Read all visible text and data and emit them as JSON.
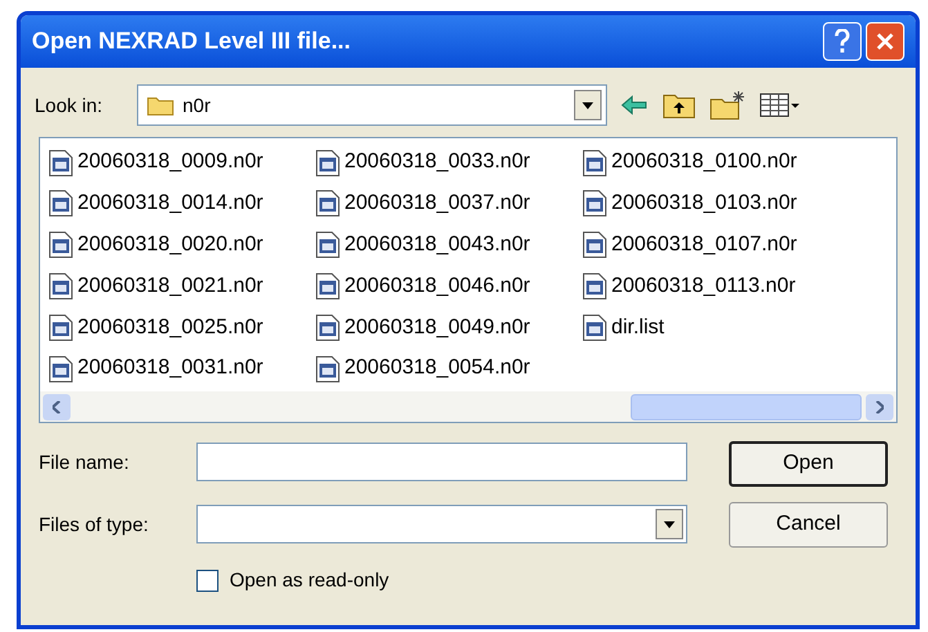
{
  "window": {
    "title": "Open NEXRAD Level III file..."
  },
  "look_in": {
    "label": "Look in:",
    "value": "n0r"
  },
  "files": [
    {
      "name": "20060318_0009.n0r",
      "selected": false
    },
    {
      "name": "20060318_0014.n0r",
      "selected": false
    },
    {
      "name": "20060318_0020.n0r",
      "selected": false
    },
    {
      "name": "20060318_0021.n0r",
      "selected": false
    },
    {
      "name": "20060318_0025.n0r",
      "selected": false
    },
    {
      "name": "20060318_0031.n0r",
      "selected": false
    },
    {
      "name": "20060318_0033.n0r",
      "selected": false
    },
    {
      "name": "20060318_0037.n0r",
      "selected": false
    },
    {
      "name": "20060318_0043.n0r",
      "selected": false
    },
    {
      "name": "20060318_0046.n0r",
      "selected": false
    },
    {
      "name": "20060318_0049.n0r",
      "selected": false
    },
    {
      "name": "20060318_0054.n0r",
      "selected": false
    },
    {
      "name": "20060318_0100.n0r",
      "selected": false
    },
    {
      "name": "20060318_0103.n0r",
      "selected": false
    },
    {
      "name": "20060318_0107.n0r",
      "selected": false
    },
    {
      "name": "20060318_0113.n0r",
      "selected": false
    },
    {
      "name": "dir.list",
      "selected": false
    }
  ],
  "file_name": {
    "label": "File name:"
  },
  "file_type": {
    "label": "Files of type:"
  },
  "read_only": {
    "label": "Open as read-only",
    "checked": false
  },
  "buttons": [
    {
      "label": "Open",
      "default": true
    },
    {
      "label": "Cancel",
      "default": false
    }
  ]
}
